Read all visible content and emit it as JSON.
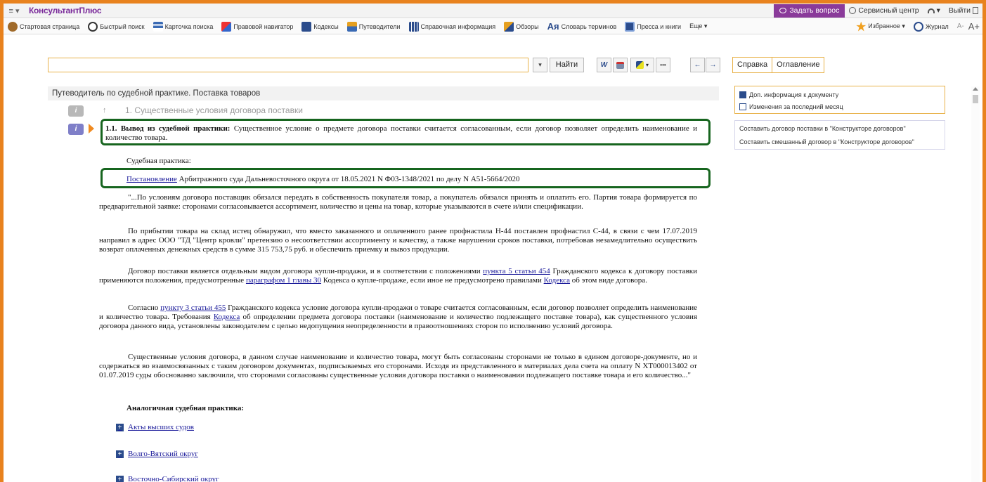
{
  "app": {
    "title": "КонсультантПлюс",
    "menu_symbol": "≡ ▾"
  },
  "topbar": {
    "ask": "Задать вопрос",
    "service": "Сервисный центр",
    "profile": "▾",
    "exit": "Выйти"
  },
  "toolbar": {
    "items": [
      "Стартовая страница",
      "Быстрый поиск",
      "Карточка поиска",
      "Правовой навигатор",
      "Кодексы",
      "Путеводители",
      "Справочная информация",
      "Обзоры",
      "Словарь терминов",
      "Пресса и книги",
      "Еще ▾"
    ],
    "dict_glyph": "Ая",
    "favorites": "Избранное ▾",
    "journal": "Журнал",
    "font_minus": "A-",
    "font_plus": "A+"
  },
  "search": {
    "value": "",
    "dropdown": "▾",
    "find": "Найти",
    "word": "W",
    "more": "•••",
    "back": "←",
    "forward": "→"
  },
  "tabs": [
    "Справка",
    "Оглавление"
  ],
  "doc": {
    "header": "Путеводитель по судебной практике. Поставка товаров",
    "up_arrow": "↑",
    "section_title": "1. Существенные условия договора поставки",
    "item_bold": "1.1. Вывод из судебной практики:",
    "item_text": " Существенное условие о предмете договора поставки считается согласованным, если договор позволяет определить наименование и количество товара.",
    "practice_label": "Судебная практика:",
    "ruling_link": "Постановление",
    "ruling_text": " Арбитражного суда Дальневосточного округа от 18.05.2021 N Ф03-1348/2021 по делу N А51-5664/2020",
    "p1": "\"...По условиям договора поставщик обязался передать в собственность покупателя товар, а покупатель обязался принять и оплатить его. Партия товара формируется по предварительной заявке: сторонами согласовывается ассортимент, количество и цены на товар, которые указываются в счете и/или спецификации.",
    "p2": "По прибытии товара на склад истец обнаружил, что вместо заказанного и оплаченного ранее профнастила Н-44 поставлен профнастил С-44, в связи с чем 17.07.2019 направил в адрес ООО \"ТД \"Центр кровли\" претензию о несоответствии ассортименту и качеству, а также нарушении сроков поставки, потребовав незамедлительно осуществить возврат оплаченных денежных средств в сумме 315 753,75 руб. и обеспечить приемку и вывоз продукции.",
    "p3a": "Договор поставки является отдельным видом договора купли-продажи, и в соответствии с положениями ",
    "p3l1": "пункта 5 статьи 454",
    "p3b": " Гражданского кодекса к договору поставки применяются положения, предусмотренные ",
    "p3l2": "параграфом 1 главы 30",
    "p3c": " Кодекса о купле-продаже, если иное не предусмотрено правилами ",
    "p3l3": "Кодекса",
    "p3d": " об этом виде договора.",
    "p4a": "Согласно ",
    "p4l1": "пункту 3 статьи 455",
    "p4b": " Гражданского кодекса условие договора купли-продажи о товаре считается согласованным, если договор позволяет определить наименование и количество товара. Требования ",
    "p4l2": "Кодекса",
    "p4c": " об определении предмета договора поставки (наименование и количество подлежащего поставке товара), как существенного условия договора данного вида, установлены законодателем с целью недопущения неопределенности в правоотношениях сторон по исполнению условий договора.",
    "p5": "Существенные условия договора, в данном случае наименование и количество товара, могут быть согласованы сторонами не только в едином договоре-документе, но и содержаться во взаимосвязанных с таким договором документах, подписываемых его сторонами. Исходя из представленного в материалах дела счета на оплату N ХТ000013402 от 01.07.2019 суды обоснованно заключили, что сторонами согласованы существенные условия договора поставки о наименовании подлежащего поставке товара и его количество...\"",
    "similar": "Аналогичная судебная практика:",
    "courts": [
      "Акты высших судов",
      "Волго-Вятский округ",
      "Восточно-Сибирский округ"
    ],
    "plus": "+"
  },
  "side": {
    "extra_info": "Доп. информация к документу",
    "changes": "Изменения за последний месяц",
    "constructor1": "Составить договор поставки в \"Конструкторе договоров\"",
    "constructor2": "Составить смешанный договор в \"Конструкторе договоров\""
  },
  "badge_letter": "i",
  "colors": {
    "frame": "#e8821e",
    "brand": "#8a3a9a",
    "highlight": "#17651f",
    "link": "#1a1a9a"
  }
}
